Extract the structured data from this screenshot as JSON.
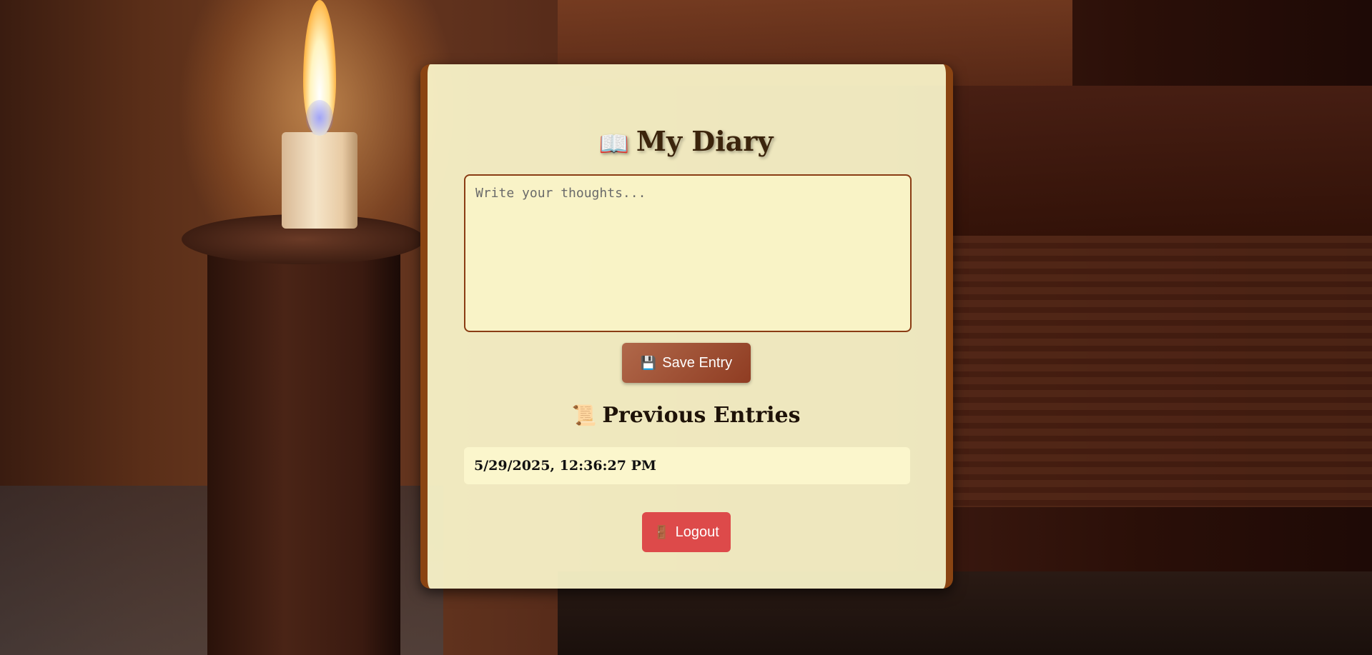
{
  "page": {
    "title": "My Diary",
    "title_icon": "📖",
    "title_icon_name": "open-book-icon"
  },
  "editor": {
    "placeholder": "Write your thoughts...",
    "value": ""
  },
  "actions": {
    "save_label": "Save Entry",
    "save_icon": "💾",
    "logout_label": "Logout",
    "logout_icon": "🚪"
  },
  "entries": {
    "heading": "Previous Entries",
    "heading_icon": "📜",
    "items": [
      {
        "timestamp": "5/29/2025, 12:36:27 PM"
      }
    ]
  },
  "colors": {
    "card_background": "#fdf8cd",
    "card_border": "#8a4412",
    "save_button": "#a3543a",
    "logout_button": "#dd4a4a",
    "title_text": "#3b240c"
  }
}
